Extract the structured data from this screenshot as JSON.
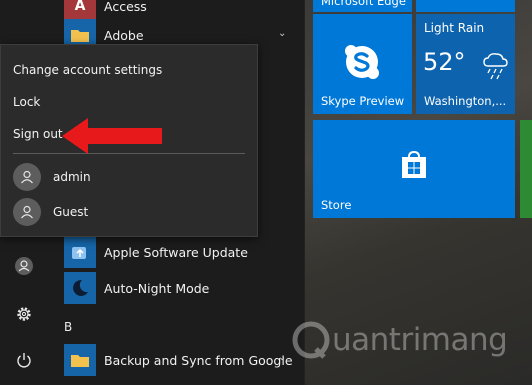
{
  "apps": [
    {
      "label": "Access"
    },
    {
      "label": "Adobe"
    },
    {
      "label": "Apple Software Update"
    },
    {
      "label": "Auto-Night Mode"
    },
    {
      "label": "Backup and Sync from Google"
    }
  ],
  "section_letter": "B",
  "account_menu": {
    "change_settings": "Change account settings",
    "lock": "Lock",
    "sign_out": "Sign out",
    "users": [
      {
        "name": "admin"
      },
      {
        "name": "Guest"
      }
    ]
  },
  "tiles": {
    "edge_partial": "Microsoft Edge",
    "skype": "Skype Preview",
    "store": "Store",
    "weather": {
      "condition": "Light Rain",
      "temperature": "52°",
      "location": "Washington,..."
    }
  },
  "watermark": "uantrimang",
  "colors": {
    "tile_blue": "#0078d7",
    "weather_blue": "#0d63ad",
    "arrow_red": "#e8191b",
    "panel_dark": "#1c1c1c",
    "popup_bg": "#2b2b2b"
  },
  "icons": {
    "rail": [
      "user-icon",
      "gear-icon",
      "power-icon"
    ],
    "apps": [
      "access-icon",
      "folder-icon",
      "apple-update-icon",
      "moon-icon",
      "folder-icon"
    ]
  }
}
